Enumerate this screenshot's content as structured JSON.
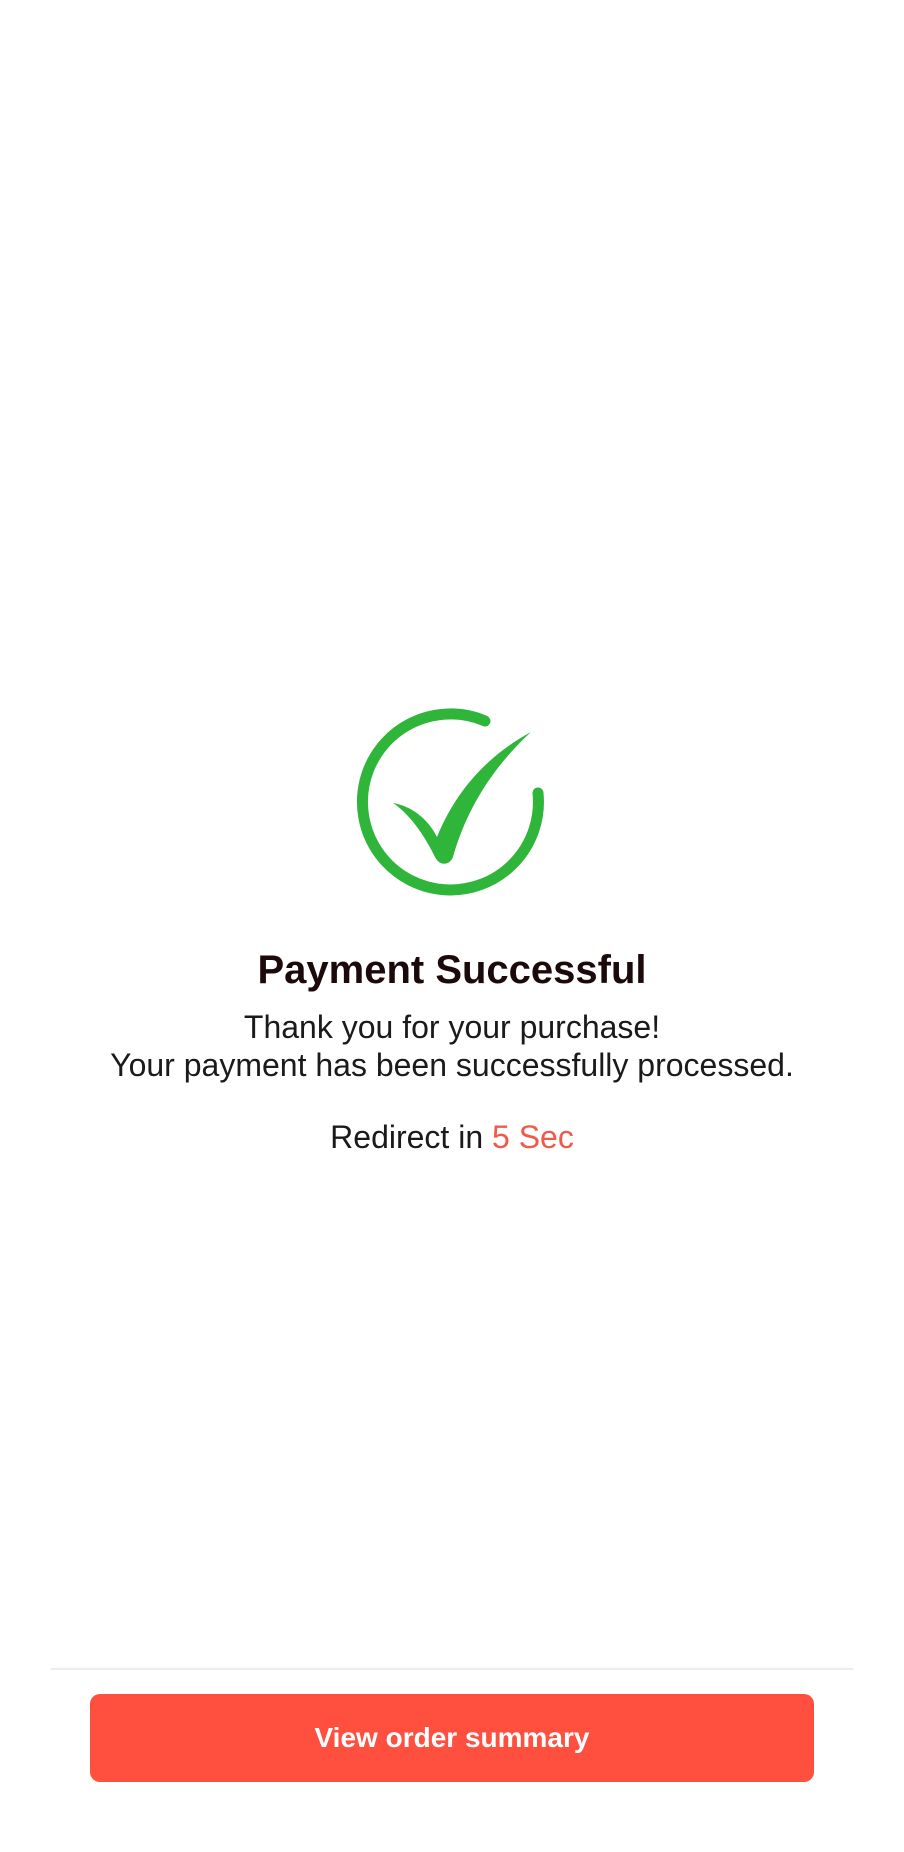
{
  "status": {
    "icon": "check-circle-icon",
    "title": "Payment Successful",
    "message_line1": "Thank you for your purchase!",
    "message_line2": "Your payment has been successfully processed.",
    "redirect_prefix": "Redirect in",
    "redirect_countdown": "5 Sec"
  },
  "footer": {
    "button_label": "View order summary"
  },
  "colors": {
    "success": "#2fb53a",
    "accent": "#fe4f3f",
    "countdown": "#f15a4a",
    "title_text": "#1c0a0a"
  }
}
